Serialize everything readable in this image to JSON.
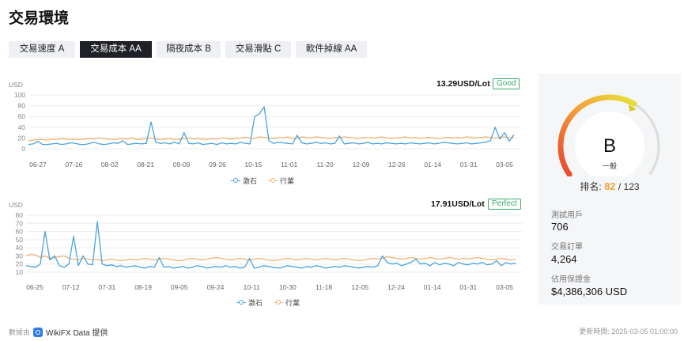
{
  "page_title": "交易環境",
  "tabs": [
    {
      "label": "交易速度 A",
      "active": false
    },
    {
      "label": "交易成本 AA",
      "active": true
    },
    {
      "label": "隔夜成本 B",
      "active": false
    },
    {
      "label": "交易滑點 C",
      "active": false
    },
    {
      "label": "軟件掉線 AA",
      "active": false
    }
  ],
  "colors": {
    "series_broker": "#4aa3df",
    "series_industry": "#f0b274",
    "good": "#3daa72",
    "rank": "#f0a63a"
  },
  "chart_data": [
    {
      "type": "line",
      "unit": "USD",
      "value_text": "13.29USD/Lot",
      "rating": "Good",
      "ylim": [
        0,
        100
      ],
      "y_ticks": [
        "100",
        "80",
        "60",
        "40",
        "20",
        "0"
      ],
      "x_tick_labels": [
        "06-27",
        "07-16",
        "08-02",
        "08-21",
        "09-09",
        "09-26",
        "10-15",
        "11-01",
        "11-20",
        "12-09",
        "12-26",
        "01-14",
        "01-31",
        "03-05"
      ],
      "series": [
        {
          "name": "激石",
          "color": "#4aa3df",
          "values": [
            8,
            9,
            14,
            8,
            8,
            9,
            10,
            8,
            9,
            11,
            10,
            8,
            8,
            10,
            12,
            9,
            8,
            9,
            11,
            10,
            15,
            8,
            9,
            10,
            9,
            10,
            50,
            12,
            10,
            11,
            9,
            12,
            9,
            30,
            10,
            9,
            11,
            8,
            9,
            10,
            8,
            11,
            9,
            10,
            9,
            12,
            10,
            9,
            60,
            65,
            78,
            15,
            10,
            12,
            11,
            10,
            9,
            25,
            11,
            9,
            10,
            12,
            10,
            11,
            9,
            10,
            24,
            9,
            10,
            11,
            9,
            10,
            12,
            9,
            10,
            9,
            11,
            10,
            9,
            10,
            9,
            11,
            10,
            9,
            10,
            11,
            9,
            10,
            12,
            11,
            10,
            9,
            10,
            11,
            9,
            10,
            11,
            12,
            15,
            40,
            18,
            30,
            14,
            26
          ]
        },
        {
          "name": "行業",
          "color": "#f0b274",
          "values": [
            15,
            16,
            17,
            17,
            16,
            18,
            17,
            19,
            18,
            17,
            18,
            17,
            18,
            19,
            18,
            20,
            19,
            18,
            17,
            18,
            19,
            18,
            20,
            17,
            18,
            19,
            20,
            18,
            17,
            18,
            19,
            17,
            18,
            19,
            20,
            18,
            19,
            18,
            17,
            19,
            18,
            20,
            19,
            18,
            19,
            20,
            21,
            20,
            19,
            22,
            21,
            20,
            19,
            21,
            20,
            22,
            19,
            20,
            22,
            21,
            20,
            22,
            21,
            20,
            19,
            21,
            20,
            22,
            21,
            20,
            19,
            21,
            20,
            20,
            21,
            22,
            20,
            19,
            20,
            21,
            22,
            20,
            21,
            19,
            20,
            21,
            20,
            19,
            20,
            21,
            20,
            21,
            20,
            22,
            21,
            20,
            21,
            22,
            21,
            20,
            21,
            22,
            20,
            21
          ]
        }
      ]
    },
    {
      "type": "line",
      "unit": "USD",
      "value_text": "17.91USD/Lot",
      "rating": "Perfect",
      "ylim": [
        10,
        80
      ],
      "y_ticks": [
        "80",
        "70",
        "60",
        "50",
        "40",
        "30",
        "20",
        "10"
      ],
      "x_tick_labels": [
        "06-25",
        "07-12",
        "07-31",
        "08-19",
        "09-05",
        "09-24",
        "10-11",
        "10-30",
        "11-18",
        "12-05",
        "12-24",
        "01-14",
        "01-31",
        "03-05"
      ],
      "series": [
        {
          "name": "激石",
          "color": "#4aa3df",
          "values": [
            18,
            17,
            16,
            20,
            60,
            25,
            30,
            18,
            16,
            20,
            54,
            18,
            30,
            20,
            19,
            72,
            20,
            18,
            19,
            17,
            18,
            16,
            17,
            18,
            16,
            15,
            17,
            16,
            28,
            16,
            17,
            15,
            16,
            17,
            15,
            16,
            18,
            17,
            15,
            16,
            17,
            16,
            18,
            16,
            17,
            15,
            16,
            27,
            15,
            16,
            18,
            17,
            16,
            15,
            16,
            18,
            17,
            16,
            15,
            17,
            16,
            18,
            17,
            15,
            16,
            17,
            16,
            18,
            17,
            16,
            15,
            16,
            17,
            16,
            18,
            30,
            22,
            20,
            21,
            18,
            20,
            22,
            26,
            20,
            21,
            18,
            22,
            19,
            21,
            20,
            18,
            22,
            20,
            19,
            21,
            20,
            22,
            19,
            20,
            24,
            18,
            22,
            20,
            21
          ]
        },
        {
          "name": "行業",
          "color": "#f0b274",
          "values": [
            30,
            32,
            31,
            28,
            30,
            27,
            28,
            29,
            30,
            27,
            26,
            25,
            27,
            26,
            25,
            26,
            24,
            25,
            26,
            25,
            24,
            25,
            26,
            25,
            26,
            27,
            26,
            25,
            26,
            27,
            26,
            25,
            24,
            25,
            26,
            27,
            26,
            25,
            26,
            27,
            28,
            27,
            26,
            25,
            26,
            27,
            26,
            25,
            26,
            27,
            26,
            25,
            24,
            25,
            26,
            27,
            26,
            25,
            26,
            27,
            26,
            25,
            26,
            27,
            26,
            25,
            26,
            27,
            26,
            25,
            24,
            25,
            26,
            27,
            26,
            27,
            29,
            28,
            27,
            26,
            27,
            28,
            27,
            26,
            27,
            28,
            27,
            26,
            27,
            28,
            27,
            26,
            27,
            26,
            27,
            28,
            27,
            26,
            25,
            26,
            27,
            26,
            25,
            26
          ]
        }
      ]
    }
  ],
  "gauge": {
    "grade": "B",
    "grade_label": "一般",
    "rank_prefix": "排名:",
    "rank": "82",
    "rank_total": "/ 123",
    "level": 0.62
  },
  "stats": [
    {
      "label": "測試用戶",
      "value": "706"
    },
    {
      "label": "交易訂單",
      "value": "4,264"
    },
    {
      "label": "佔用保證金",
      "value": "$4,386,306 USD"
    }
  ],
  "footer": {
    "source_prefix": "數據由",
    "source_brand": "WikiFX Data 提供",
    "updated": "更新時間: 2025-03-05 01:00:00"
  }
}
